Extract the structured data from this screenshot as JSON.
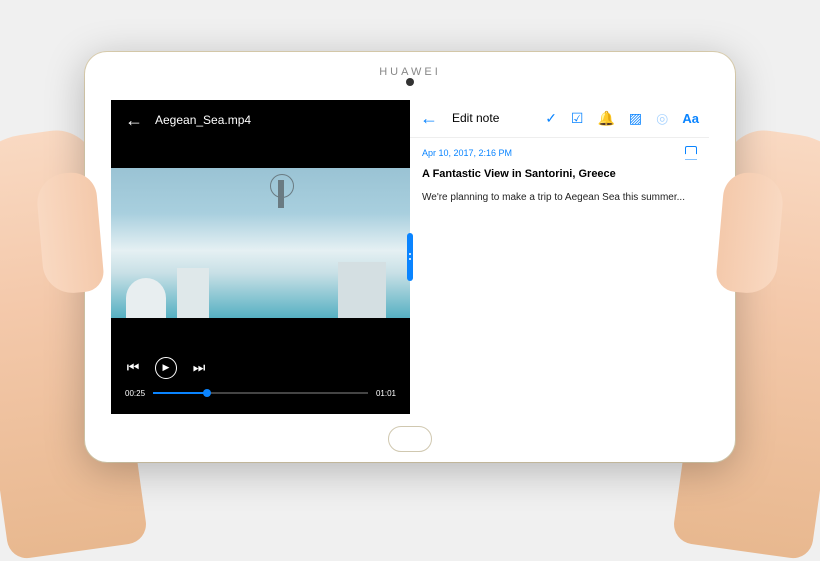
{
  "device": {
    "brand": "HUAWEI"
  },
  "video": {
    "filename": "Aegean_Sea.mp4",
    "current_time": "00:25",
    "duration": "01:01"
  },
  "note": {
    "header_title": "Edit note",
    "aa_label": "Aa",
    "timestamp": "Apr 10, 2017, 2:16 PM",
    "heading": "A Fantastic View in Santorini, Greece",
    "body": "We're planning to make a trip to Aegean Sea this summer..."
  }
}
